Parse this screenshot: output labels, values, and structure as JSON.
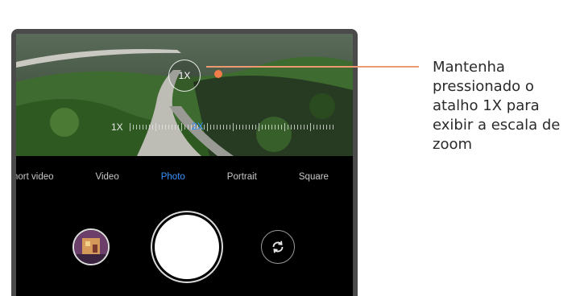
{
  "callout": {
    "text": "Mantenha pressionado o atalho 1X para exibir a escala de zoom"
  },
  "viewfinder": {
    "zoom_button_label": "1X",
    "zoom_scale_label": "1X",
    "zoom_scale_active": "2X"
  },
  "modes": [
    {
      "label": "hort video"
    },
    {
      "label": "Video"
    },
    {
      "label": "Photo",
      "active": true
    },
    {
      "label": "Portrait"
    },
    {
      "label": "Square"
    }
  ],
  "colors": {
    "active_mode": "#3a95ff",
    "callout_accent": "#f07d4a"
  }
}
